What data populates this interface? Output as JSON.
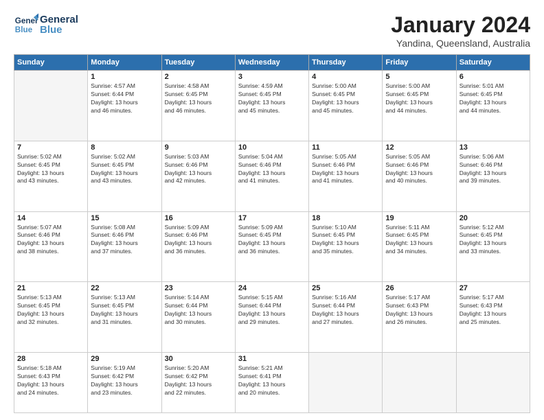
{
  "header": {
    "logo_general": "General",
    "logo_blue": "Blue",
    "month_title": "January 2024",
    "location": "Yandina, Queensland, Australia"
  },
  "weekdays": [
    "Sunday",
    "Monday",
    "Tuesday",
    "Wednesday",
    "Thursday",
    "Friday",
    "Saturday"
  ],
  "weeks": [
    [
      {
        "day": "",
        "sunrise": "",
        "sunset": "",
        "daylight": ""
      },
      {
        "day": "1",
        "sunrise": "Sunrise: 4:57 AM",
        "sunset": "Sunset: 6:44 PM",
        "daylight": "Daylight: 13 hours and 46 minutes."
      },
      {
        "day": "2",
        "sunrise": "Sunrise: 4:58 AM",
        "sunset": "Sunset: 6:45 PM",
        "daylight": "Daylight: 13 hours and 46 minutes."
      },
      {
        "day": "3",
        "sunrise": "Sunrise: 4:59 AM",
        "sunset": "Sunset: 6:45 PM",
        "daylight": "Daylight: 13 hours and 45 minutes."
      },
      {
        "day": "4",
        "sunrise": "Sunrise: 5:00 AM",
        "sunset": "Sunset: 6:45 PM",
        "daylight": "Daylight: 13 hours and 45 minutes."
      },
      {
        "day": "5",
        "sunrise": "Sunrise: 5:00 AM",
        "sunset": "Sunset: 6:45 PM",
        "daylight": "Daylight: 13 hours and 44 minutes."
      },
      {
        "day": "6",
        "sunrise": "Sunrise: 5:01 AM",
        "sunset": "Sunset: 6:45 PM",
        "daylight": "Daylight: 13 hours and 44 minutes."
      }
    ],
    [
      {
        "day": "7",
        "sunrise": "Sunrise: 5:02 AM",
        "sunset": "Sunset: 6:45 PM",
        "daylight": "Daylight: 13 hours and 43 minutes."
      },
      {
        "day": "8",
        "sunrise": "Sunrise: 5:02 AM",
        "sunset": "Sunset: 6:45 PM",
        "daylight": "Daylight: 13 hours and 43 minutes."
      },
      {
        "day": "9",
        "sunrise": "Sunrise: 5:03 AM",
        "sunset": "Sunset: 6:46 PM",
        "daylight": "Daylight: 13 hours and 42 minutes."
      },
      {
        "day": "10",
        "sunrise": "Sunrise: 5:04 AM",
        "sunset": "Sunset: 6:46 PM",
        "daylight": "Daylight: 13 hours and 41 minutes."
      },
      {
        "day": "11",
        "sunrise": "Sunrise: 5:05 AM",
        "sunset": "Sunset: 6:46 PM",
        "daylight": "Daylight: 13 hours and 41 minutes."
      },
      {
        "day": "12",
        "sunrise": "Sunrise: 5:05 AM",
        "sunset": "Sunset: 6:46 PM",
        "daylight": "Daylight: 13 hours and 40 minutes."
      },
      {
        "day": "13",
        "sunrise": "Sunrise: 5:06 AM",
        "sunset": "Sunset: 6:46 PM",
        "daylight": "Daylight: 13 hours and 39 minutes."
      }
    ],
    [
      {
        "day": "14",
        "sunrise": "Sunrise: 5:07 AM",
        "sunset": "Sunset: 6:46 PM",
        "daylight": "Daylight: 13 hours and 38 minutes."
      },
      {
        "day": "15",
        "sunrise": "Sunrise: 5:08 AM",
        "sunset": "Sunset: 6:46 PM",
        "daylight": "Daylight: 13 hours and 37 minutes."
      },
      {
        "day": "16",
        "sunrise": "Sunrise: 5:09 AM",
        "sunset": "Sunset: 6:46 PM",
        "daylight": "Daylight: 13 hours and 36 minutes."
      },
      {
        "day": "17",
        "sunrise": "Sunrise: 5:09 AM",
        "sunset": "Sunset: 6:45 PM",
        "daylight": "Daylight: 13 hours and 36 minutes."
      },
      {
        "day": "18",
        "sunrise": "Sunrise: 5:10 AM",
        "sunset": "Sunset: 6:45 PM",
        "daylight": "Daylight: 13 hours and 35 minutes."
      },
      {
        "day": "19",
        "sunrise": "Sunrise: 5:11 AM",
        "sunset": "Sunset: 6:45 PM",
        "daylight": "Daylight: 13 hours and 34 minutes."
      },
      {
        "day": "20",
        "sunrise": "Sunrise: 5:12 AM",
        "sunset": "Sunset: 6:45 PM",
        "daylight": "Daylight: 13 hours and 33 minutes."
      }
    ],
    [
      {
        "day": "21",
        "sunrise": "Sunrise: 5:13 AM",
        "sunset": "Sunset: 6:45 PM",
        "daylight": "Daylight: 13 hours and 32 minutes."
      },
      {
        "day": "22",
        "sunrise": "Sunrise: 5:13 AM",
        "sunset": "Sunset: 6:45 PM",
        "daylight": "Daylight: 13 hours and 31 minutes."
      },
      {
        "day": "23",
        "sunrise": "Sunrise: 5:14 AM",
        "sunset": "Sunset: 6:44 PM",
        "daylight": "Daylight: 13 hours and 30 minutes."
      },
      {
        "day": "24",
        "sunrise": "Sunrise: 5:15 AM",
        "sunset": "Sunset: 6:44 PM",
        "daylight": "Daylight: 13 hours and 29 minutes."
      },
      {
        "day": "25",
        "sunrise": "Sunrise: 5:16 AM",
        "sunset": "Sunset: 6:44 PM",
        "daylight": "Daylight: 13 hours and 27 minutes."
      },
      {
        "day": "26",
        "sunrise": "Sunrise: 5:17 AM",
        "sunset": "Sunset: 6:43 PM",
        "daylight": "Daylight: 13 hours and 26 minutes."
      },
      {
        "day": "27",
        "sunrise": "Sunrise: 5:17 AM",
        "sunset": "Sunset: 6:43 PM",
        "daylight": "Daylight: 13 hours and 25 minutes."
      }
    ],
    [
      {
        "day": "28",
        "sunrise": "Sunrise: 5:18 AM",
        "sunset": "Sunset: 6:43 PM",
        "daylight": "Daylight: 13 hours and 24 minutes."
      },
      {
        "day": "29",
        "sunrise": "Sunrise: 5:19 AM",
        "sunset": "Sunset: 6:42 PM",
        "daylight": "Daylight: 13 hours and 23 minutes."
      },
      {
        "day": "30",
        "sunrise": "Sunrise: 5:20 AM",
        "sunset": "Sunset: 6:42 PM",
        "daylight": "Daylight: 13 hours and 22 minutes."
      },
      {
        "day": "31",
        "sunrise": "Sunrise: 5:21 AM",
        "sunset": "Sunset: 6:41 PM",
        "daylight": "Daylight: 13 hours and 20 minutes."
      },
      {
        "day": "",
        "sunrise": "",
        "sunset": "",
        "daylight": ""
      },
      {
        "day": "",
        "sunrise": "",
        "sunset": "",
        "daylight": ""
      },
      {
        "day": "",
        "sunrise": "",
        "sunset": "",
        "daylight": ""
      }
    ]
  ]
}
